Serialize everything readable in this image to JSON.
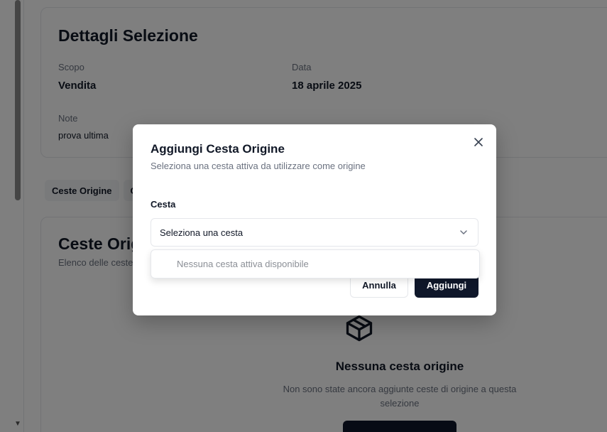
{
  "details": {
    "title": "Dettagli Selezione",
    "scope_label": "Scopo",
    "scope_value": "Vendita",
    "date_label": "Data",
    "date_value": "18 aprile 2025",
    "notes_label": "Note",
    "notes_value": "prova ultima"
  },
  "tabs": [
    {
      "label": "Ceste Origine"
    },
    {
      "label": "C"
    }
  ],
  "ceste": {
    "title": "Ceste Origine",
    "subtitle": "Elenco delle ceste",
    "empty_title": "Nessuna cesta origine",
    "empty_text": "Non sono state ancora aggiunte ceste di origine a questa selezione"
  },
  "dialog": {
    "title": "Aggiungi Cesta Origine",
    "subtitle": "Seleziona una cesta attiva da utilizzare come origine",
    "field_label": "Cesta",
    "select_placeholder": "Seleziona una cesta",
    "empty_option": "Nessuna cesta attiva disponibile",
    "cancel_label": "Annulla",
    "add_label": "Aggiungi",
    "close_icon": "close-icon"
  },
  "colors": {
    "primary": "#0f172a",
    "overlay": "rgba(0,0,0,0.5)",
    "muted_text": "#6b7280"
  }
}
